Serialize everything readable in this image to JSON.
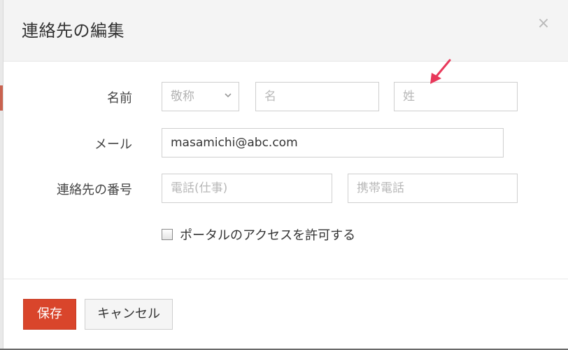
{
  "dialog": {
    "title": "連絡先の編集",
    "close_symbol": "×"
  },
  "name_row": {
    "label": "名前",
    "salutation_placeholder": "敬称",
    "first_name_placeholder": "名",
    "last_name_placeholder": "姓"
  },
  "email_row": {
    "label": "メール",
    "value": "masamichi@abc.com"
  },
  "phone_row": {
    "label": "連絡先の番号",
    "work_phone_placeholder": "電話(仕事)",
    "mobile_phone_placeholder": "携帯電話"
  },
  "portal": {
    "label": "ポータルのアクセスを許可する",
    "checked": false
  },
  "buttons": {
    "save": "保存",
    "cancel": "キャンセル"
  },
  "colors": {
    "accent": "#d9452b",
    "annotation_arrow": "#e8385a"
  },
  "icons": {
    "close": "close-icon",
    "salutation_dropdown": "chevron-down-icon",
    "annotation": "annotation-arrow-icon"
  }
}
